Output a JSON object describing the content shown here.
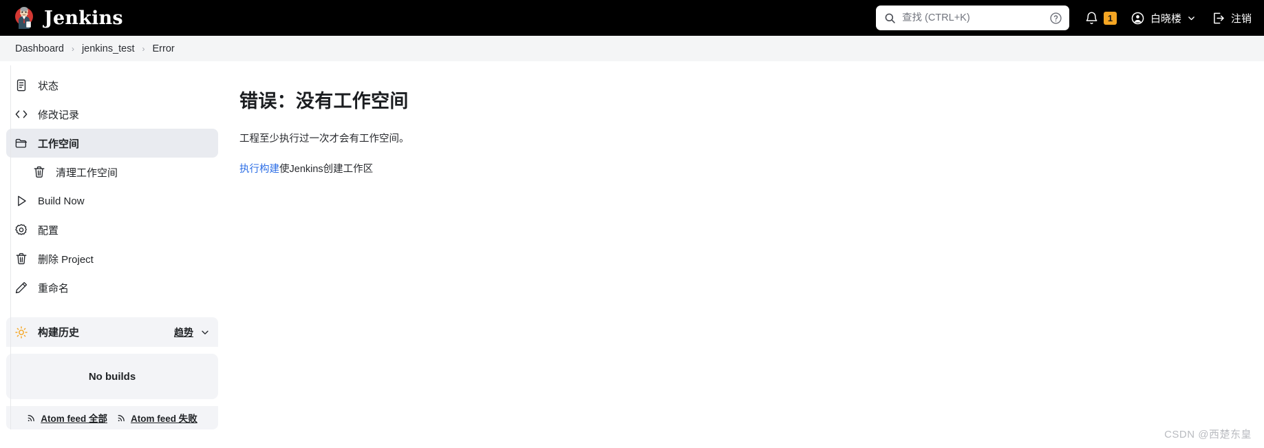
{
  "header": {
    "brand": "Jenkins",
    "logo_icon": "jenkins-butler-logo",
    "search": {
      "icon": "search-icon",
      "placeholder": "查找 (CTRL+K)",
      "value": "",
      "help_icon": "help-circle-icon"
    },
    "notifications": {
      "icon": "bell-icon",
      "count": "1",
      "badge_color": "#f5a623"
    },
    "user": {
      "avatar_icon": "user-circle-icon",
      "name": "白晓楼",
      "chevron_icon": "chevron-down-icon"
    },
    "logout": {
      "icon": "logout-icon",
      "label": "注销"
    },
    "background_color": "#000000"
  },
  "breadcrumb": {
    "separator": "›",
    "items": [
      {
        "label": "Dashboard"
      },
      {
        "label": "jenkins_test"
      },
      {
        "label": "Error"
      }
    ]
  },
  "sidebar": {
    "items": [
      {
        "label": "状态",
        "icon": "document-status-icon",
        "active": false,
        "sub": false
      },
      {
        "label": "修改记录",
        "icon": "code-brackets-icon",
        "active": false,
        "sub": false
      },
      {
        "label": "工作空间",
        "icon": "folder-icon",
        "active": true,
        "sub": false
      },
      {
        "label": "清理工作空间",
        "icon": "trash-icon",
        "active": false,
        "sub": true
      },
      {
        "label": "Build Now",
        "icon": "play-triangle-icon",
        "active": false,
        "sub": false
      },
      {
        "label": "配置",
        "icon": "gear-icon",
        "active": false,
        "sub": false
      },
      {
        "label": "删除 Project",
        "icon": "trash-icon",
        "active": false,
        "sub": false
      },
      {
        "label": "重命名",
        "icon": "pencil-icon",
        "active": false,
        "sub": false
      }
    ],
    "build_history": {
      "icon": "sun-weather-icon",
      "icon_color": "#f5a623",
      "title": "构建历史",
      "trend_label": "趋势",
      "trend_chevron_icon": "chevron-down-icon",
      "empty_label": "No builds",
      "feeds": [
        {
          "label": "Atom feed 全部",
          "icon": "rss-feed-icon"
        },
        {
          "label": "Atom feed 失败",
          "icon": "rss-feed-icon"
        }
      ]
    }
  },
  "main": {
    "title": "错误：没有工作空间",
    "description": "工程至少执行过一次才会有工作空间。",
    "action_link": "执行构建",
    "action_suffix": "使Jenkins创建工作区",
    "link_color": "#2c6ee6"
  },
  "watermark": "CSDN @西楚东皇"
}
